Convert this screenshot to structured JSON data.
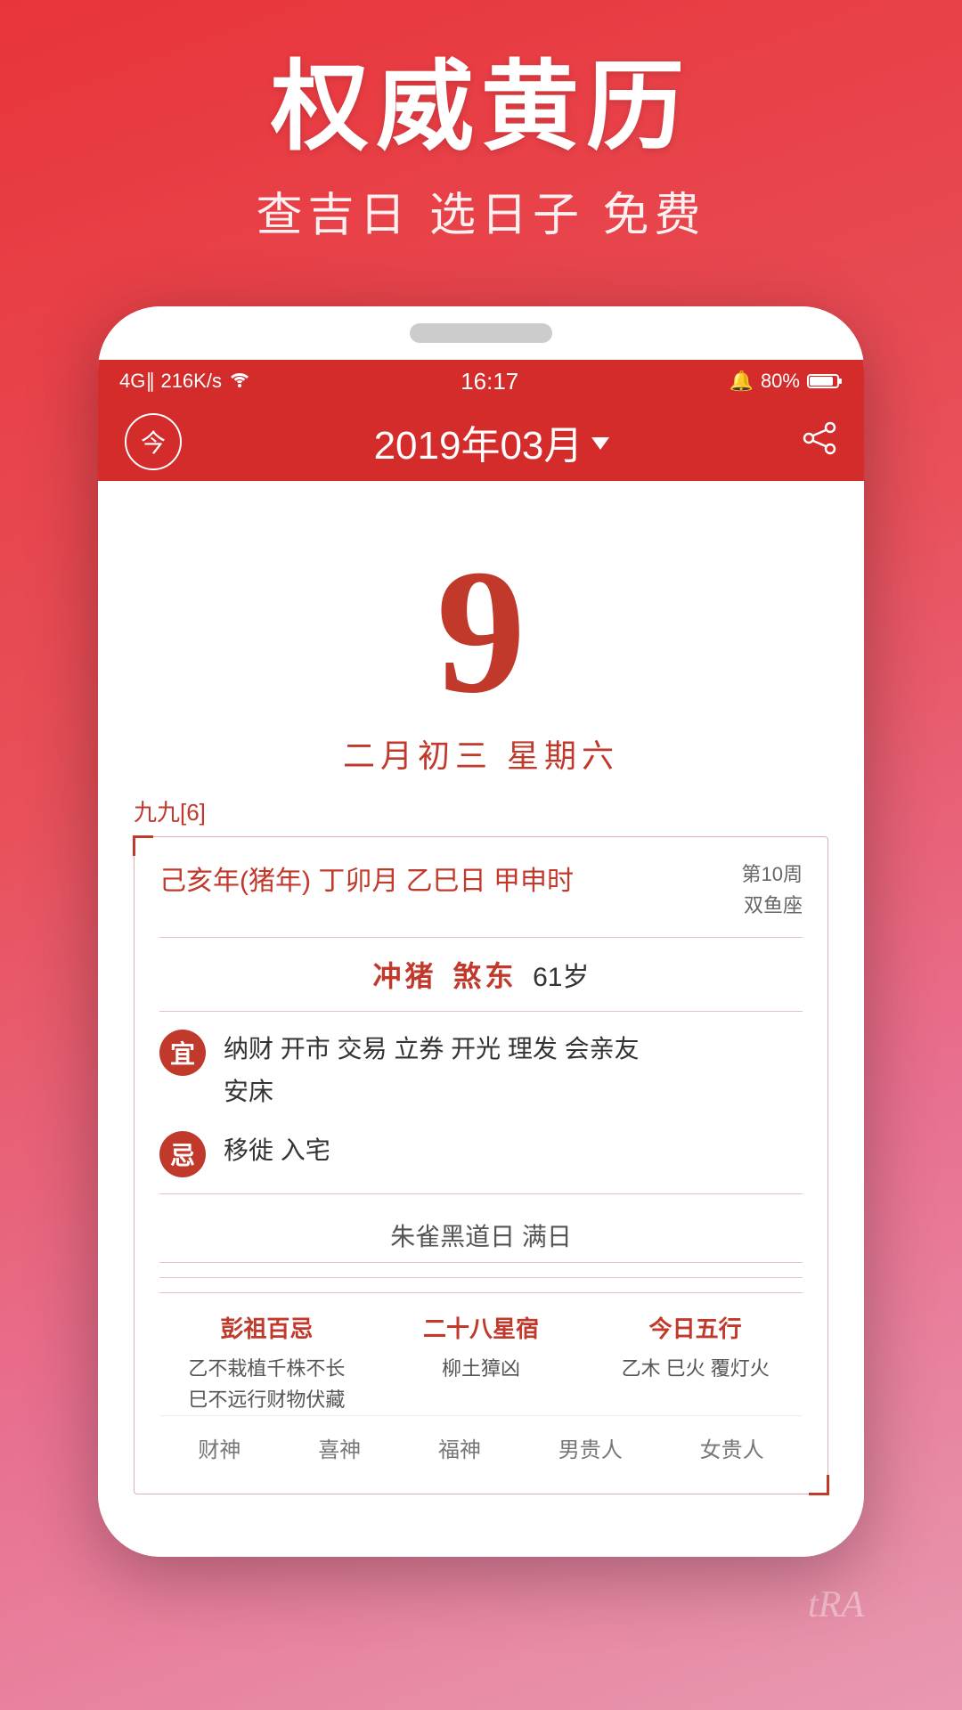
{
  "app": {
    "main_title": "权威黄历",
    "sub_title": "查吉日 选日子 免费"
  },
  "status_bar": {
    "signal": "4G∥ 216K/s",
    "wifi": "▾",
    "time": "16:17",
    "alarm": "🔔",
    "battery": "80%"
  },
  "header": {
    "today_label": "今",
    "month_title": "2019年03月",
    "dropdown_label": "▼"
  },
  "calendar": {
    "day_number": "9",
    "lunar_date": "二月初三  星期六",
    "nine_nine": "九九[6]"
  },
  "info_card": {
    "ganzhi": "己亥年(猪年) 丁卯月  乙巳日  甲申时",
    "week_label": "第10周",
    "zodiac": "双鱼座",
    "chong": "冲猪",
    "sha": "煞东",
    "age": "61岁",
    "yi_label": "宜",
    "yi_content": "纳财 开市 交易 立券 开光 理发 会亲友\n安床",
    "ji_label": "忌",
    "ji_content": "移徙 入宅",
    "special_day": "朱雀黑道日  满日",
    "col1_title": "彭祖百忌",
    "col1_content": "乙不栽植千株不长\n巳不远行财物伏藏",
    "col2_title": "二十八星宿",
    "col2_content": "柳土獐凶",
    "col3_title": "今日五行",
    "col3_content": "乙木 巳火 覆灯火"
  },
  "footer": {
    "labels": [
      "财神",
      "喜神",
      "福神",
      "男贵人",
      "女贵人"
    ]
  },
  "watermark": {
    "text": "tRA"
  }
}
